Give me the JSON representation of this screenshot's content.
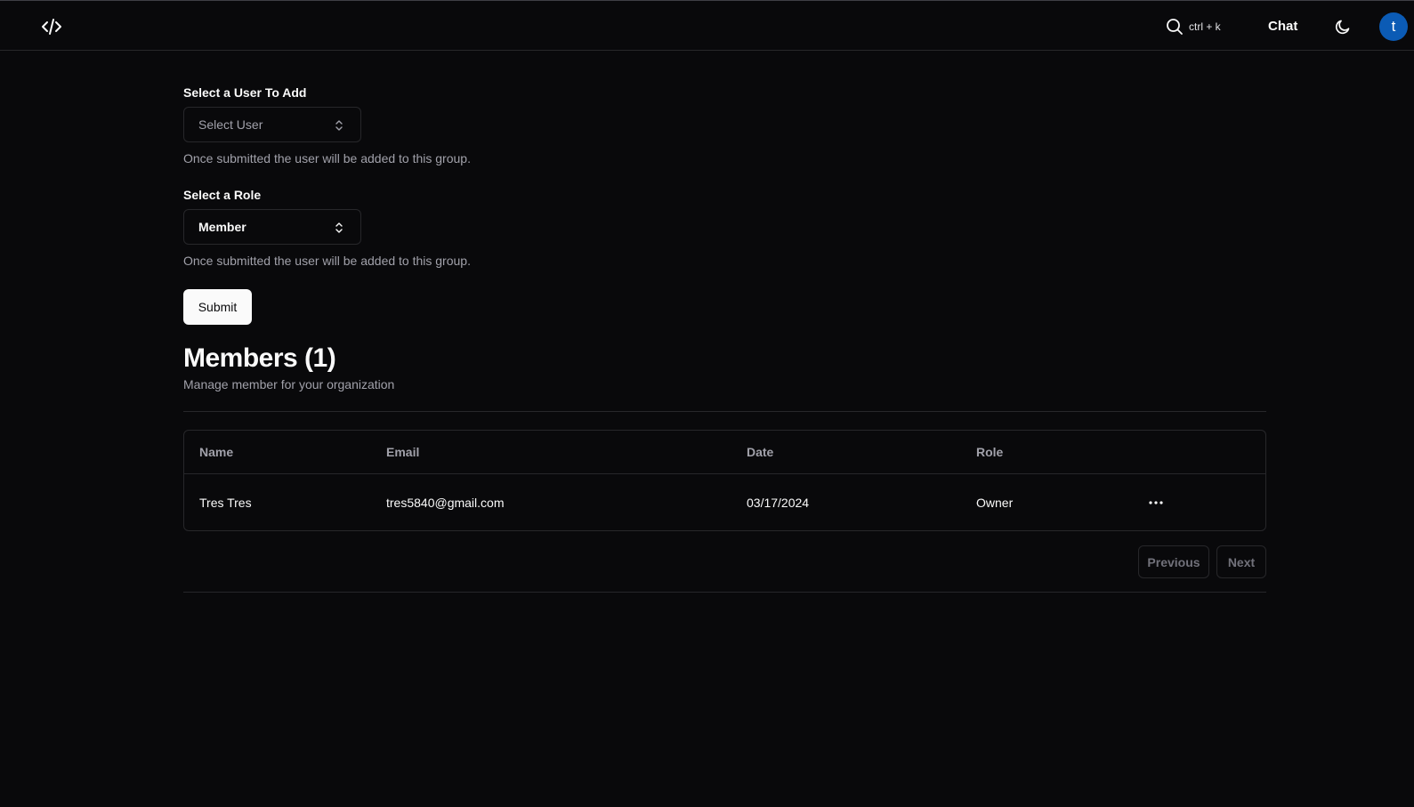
{
  "header": {
    "search_shortcut": "ctrl + k",
    "chat_label": "Chat",
    "avatar_initial": "t"
  },
  "form": {
    "user_label": "Select a User To Add",
    "user_select_placeholder": "Select User",
    "user_help": "Once submitted the user will be added to this group.",
    "role_label": "Select a Role",
    "role_select_value": "Member",
    "role_help": "Once submitted the user will be added to this group.",
    "submit_label": "Submit"
  },
  "members": {
    "title": "Members (1)",
    "subtitle": "Manage member for your organization",
    "columns": [
      "Name",
      "Email",
      "Date",
      "Role"
    ],
    "rows": [
      {
        "name": "Tres Tres",
        "email": "tres5840@gmail.com",
        "date": "03/17/2024",
        "role": "Owner"
      }
    ],
    "pagination": {
      "previous": "Previous",
      "next": "Next"
    }
  },
  "colors": {
    "background": "#09090b",
    "border": "#27272a",
    "muted_text": "#a1a1aa",
    "avatar_bg": "#0b5bb5"
  },
  "icons": {
    "logo": "code-icon",
    "search": "search-icon",
    "theme": "moon-icon",
    "select": "chevrons-up-down-icon",
    "row_actions": "more-horizontal-icon"
  }
}
